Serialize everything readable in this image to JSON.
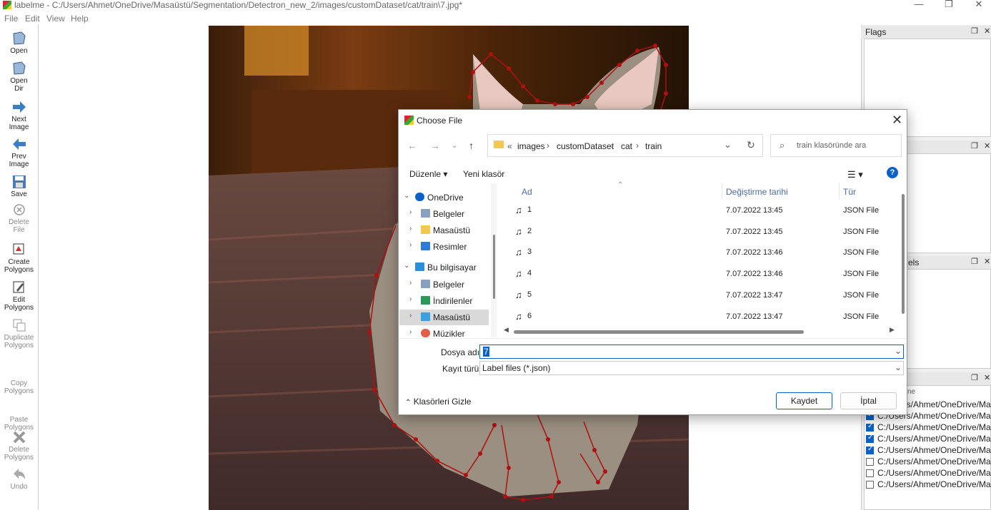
{
  "window": {
    "title": "labelme - C:/Users/Ahmet/OneDrive/Masaüstü/Segmentation/Detectron_new_2/images/customDataset/cat/train\\7.jpg*",
    "minimize": "—",
    "maximize": "❐",
    "close": "✕"
  },
  "menu": [
    "File",
    "Edit",
    "View",
    "Help"
  ],
  "toolbar": [
    {
      "label1": "Open",
      "label2": "",
      "icon": "folder-icon",
      "enabled": true
    },
    {
      "label1": "Open",
      "label2": "Dir",
      "icon": "folder-icon",
      "enabled": true
    },
    {
      "label1": "Next",
      "label2": "Image",
      "icon": "arrow-right-icon",
      "enabled": true
    },
    {
      "label1": "Prev",
      "label2": "Image",
      "icon": "arrow-left-icon",
      "enabled": true
    },
    {
      "label1": "Save",
      "label2": "",
      "icon": "save-icon",
      "enabled": true
    },
    {
      "label1": "Delete",
      "label2": "File",
      "icon": "delete-file-icon",
      "enabled": false
    },
    {
      "label1": "Create",
      "label2": "Polygons",
      "icon": "create-polygon-icon",
      "enabled": true
    },
    {
      "label1": "Edit",
      "label2": "Polygons",
      "icon": "edit-polygon-icon",
      "enabled": true
    },
    {
      "label1": "Duplicate",
      "label2": "Polygons",
      "icon": "duplicate-icon",
      "enabled": false
    },
    {
      "label1": "Copy",
      "label2": "Polygons",
      "icon": "",
      "enabled": false
    },
    {
      "label1": "Paste",
      "label2": "Polygons",
      "icon": "",
      "enabled": false
    },
    {
      "label1": "Delete",
      "label2": "Polygons",
      "icon": "delete-icon",
      "enabled": false
    },
    {
      "label1": "Undo",
      "label2": "",
      "icon": "undo-icon",
      "enabled": false
    }
  ],
  "docks": {
    "flags_title": "Flags",
    "labels_title_partial": "els",
    "filelist_header_partial": "ne",
    "files": [
      {
        "path": "C:/Users/Ahmet/OneDrive/Masaü",
        "checked": true
      },
      {
        "path": "C:/Users/Ahmet/OneDrive/Masaü",
        "checked": true
      },
      {
        "path": "C:/Users/Ahmet/OneDrive/Masaü",
        "checked": true
      },
      {
        "path": "C:/Users/Ahmet/OneDrive/Masaü",
        "checked": true
      },
      {
        "path": "C:/Users/Ahmet/OneDrive/Masaü",
        "checked": true
      },
      {
        "path": "C:/Users/Ahmet/OneDrive/Masaü",
        "checked": false
      },
      {
        "path": "C:/Users/Ahmet/OneDrive/Masaü",
        "checked": false
      },
      {
        "path": "C:/Users/Ahmet/OneDrive/Masaü",
        "checked": false
      }
    ]
  },
  "dialog": {
    "title": "Choose File",
    "breadcrumb": [
      "images",
      "customDataset",
      "cat",
      "train"
    ],
    "breadcrumb_prefix": "«",
    "search_placeholder": "train klasöründe ara",
    "organize": "Düzenle ▾",
    "new_folder": "Yeni klasör",
    "nav": [
      {
        "label": "OneDrive",
        "level": 0,
        "expanded": true,
        "icon": "cloud-icon",
        "selected": false
      },
      {
        "label": "Belgeler",
        "level": 1,
        "expanded": false,
        "icon": "document-icon",
        "selected": false
      },
      {
        "label": "Masaüstü",
        "level": 1,
        "expanded": false,
        "icon": "folder-icon",
        "selected": false
      },
      {
        "label": "Resimler",
        "level": 1,
        "expanded": false,
        "icon": "image-icon",
        "selected": false
      },
      {
        "label": "Bu bilgisayar",
        "level": 0,
        "expanded": true,
        "icon": "computer-icon",
        "selected": false
      },
      {
        "label": "Belgeler",
        "level": 1,
        "expanded": false,
        "icon": "document-icon",
        "selected": false
      },
      {
        "label": "İndirilenler",
        "level": 1,
        "expanded": false,
        "icon": "download-icon",
        "selected": false
      },
      {
        "label": "Masaüstü",
        "level": 1,
        "expanded": false,
        "icon": "desktop-icon",
        "selected": true
      },
      {
        "label": "Müzikler",
        "level": 1,
        "expanded": false,
        "icon": "music-icon",
        "selected": false
      }
    ],
    "columns": {
      "name": "Ad",
      "date": "Değiştirme tarihi",
      "type": "Tür"
    },
    "files": [
      {
        "name": "1",
        "date": "7.07.2022 13:45",
        "type": "JSON File"
      },
      {
        "name": "2",
        "date": "7.07.2022 13:45",
        "type": "JSON File"
      },
      {
        "name": "3",
        "date": "7.07.2022 13:46",
        "type": "JSON File"
      },
      {
        "name": "4",
        "date": "7.07.2022 13:46",
        "type": "JSON File"
      },
      {
        "name": "5",
        "date": "7.07.2022 13:47",
        "type": "JSON File"
      },
      {
        "name": "6",
        "date": "7.07.2022 13:47",
        "type": "JSON File"
      }
    ],
    "filename_label": "Dosya adı:",
    "filename_value": "7",
    "filetype_label": "Kayıt türü:",
    "filetype_value": "Label files (*.json)",
    "hide_folders": "Klasörleri Gizle",
    "save": "Kaydet",
    "cancel": "İptal"
  },
  "colors": {
    "accent": "#0a62c9",
    "polygon": "#b01010"
  }
}
